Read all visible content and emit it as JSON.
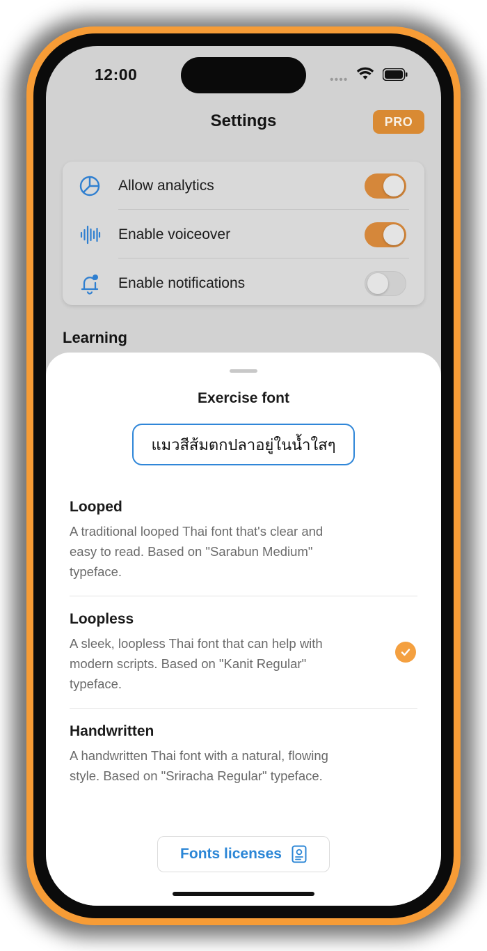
{
  "status_bar": {
    "time": "12:00"
  },
  "header": {
    "title": "Settings",
    "badge": "PRO"
  },
  "settings": {
    "items": [
      {
        "label": "Allow analytics",
        "icon": "pie-chart-icon",
        "enabled": true
      },
      {
        "label": "Enable voiceover",
        "icon": "sound-wave-icon",
        "enabled": true
      },
      {
        "label": "Enable notifications",
        "icon": "bell-icon",
        "enabled": false
      }
    ]
  },
  "section": {
    "title": "Learning"
  },
  "sheet": {
    "title": "Exercise font",
    "preview_text": "แมวสีส้มตกปลาอยู่ในน้ำใสๆ",
    "options": [
      {
        "name": "Looped",
        "description": "A traditional looped Thai font that's clear and easy to read. Based on \"Sarabun Medium\" typeface.",
        "selected": false
      },
      {
        "name": "Loopless",
        "description": "A sleek, loopless Thai font that can help with modern scripts. Based on \"Kanit Regular\" typeface.",
        "selected": true
      },
      {
        "name": "Handwritten",
        "description": "A handwritten Thai font with a natural, flowing style. Based on \"Sriracha Regular\" typeface.",
        "selected": false
      }
    ],
    "licenses_label": "Fonts licenses"
  },
  "colors": {
    "accent": "#f4a040",
    "toggle_on": "#d5873a",
    "link_blue": "#2b86d6",
    "frame_orange": "#f79c36"
  }
}
